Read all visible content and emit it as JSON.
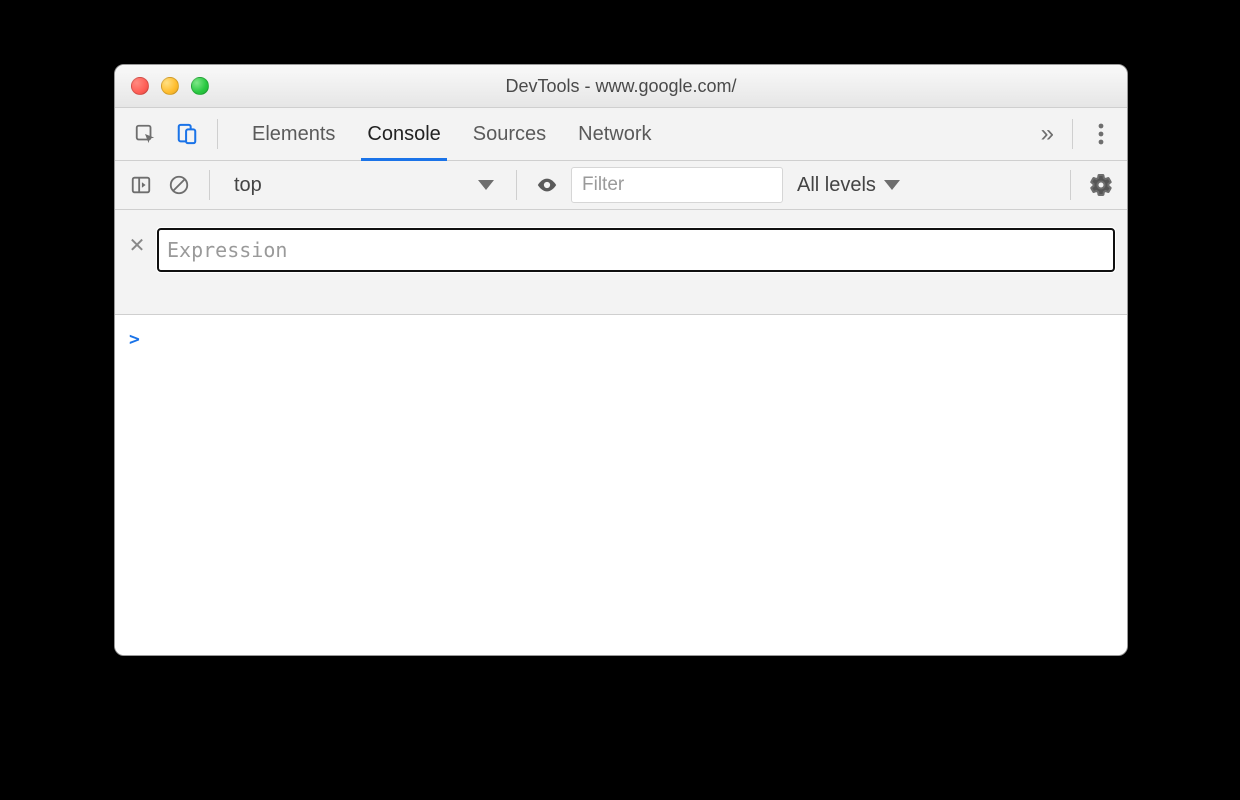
{
  "window": {
    "title": "DevTools - www.google.com/"
  },
  "tabstrip": {
    "inspect_icon": "inspect",
    "device_icon": "device",
    "tabs": [
      {
        "label": "Elements",
        "active": false
      },
      {
        "label": "Console",
        "active": true
      },
      {
        "label": "Sources",
        "active": false
      },
      {
        "label": "Network",
        "active": false
      }
    ],
    "more_label": "»"
  },
  "console_toolbar": {
    "context_label": "top",
    "filter_placeholder": "Filter",
    "levels_label": "All levels"
  },
  "live_expression": {
    "placeholder": "Expression",
    "value": ""
  },
  "console": {
    "prompt": ">"
  }
}
